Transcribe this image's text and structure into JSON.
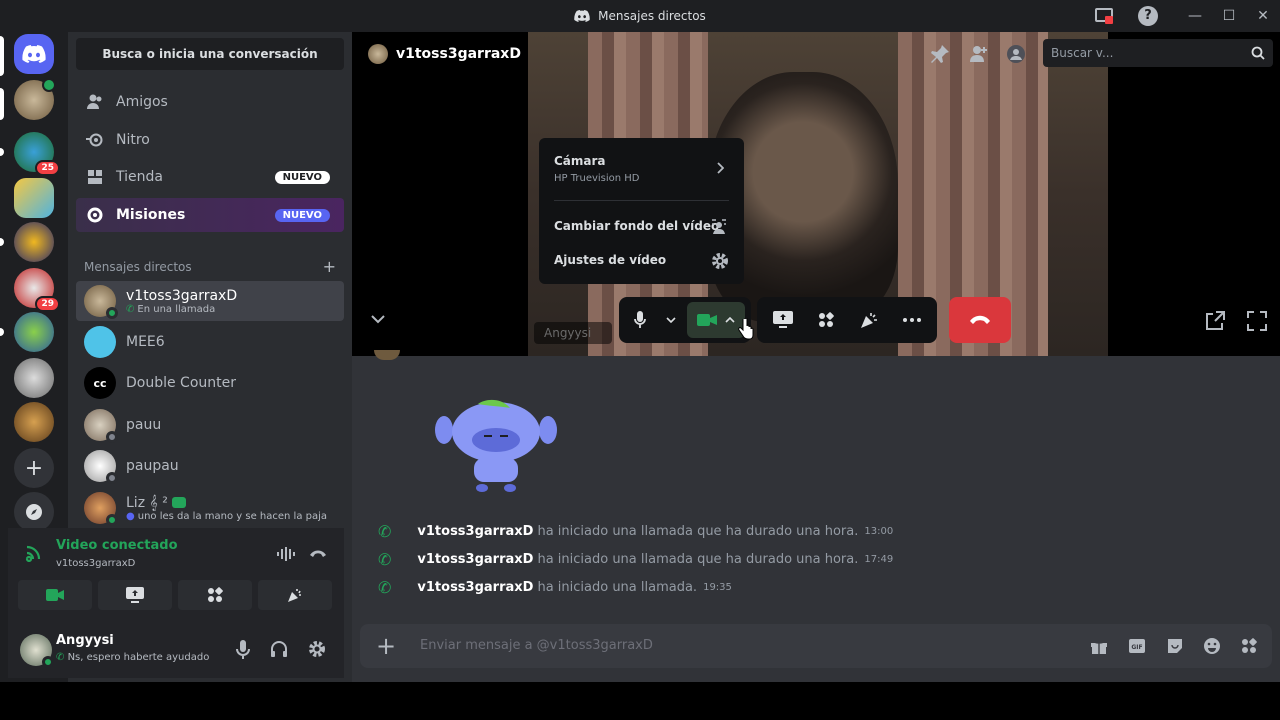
{
  "window": {
    "title": "Mensajes directos"
  },
  "sidebar": {
    "search_label": "Busca o inicia una conversación",
    "nav": [
      {
        "label": "Amigos"
      },
      {
        "label": "Nitro"
      },
      {
        "label": "Tienda",
        "badge": "NUEVO"
      },
      {
        "label": "Misiones",
        "badge": "NUEVO"
      }
    ],
    "dm_header": "Mensajes directos",
    "dm_add": "+",
    "dms": [
      {
        "name": "v1toss3garraxD",
        "status": "En una llamada"
      },
      {
        "name": "MEE6"
      },
      {
        "name": "Double Counter"
      },
      {
        "name": "pauu"
      },
      {
        "name": "paupau"
      },
      {
        "name": "Liz 𝄞 ²",
        "status": "uno les da la mano y se hacen la paja"
      }
    ]
  },
  "guild_badges": [
    "25",
    "29"
  ],
  "voice_panel": {
    "title": "Video conectado",
    "subtitle": "v1toss3garraxD"
  },
  "user_panel": {
    "name": "Angyysi",
    "status": "Ns, espero haberte ayudado"
  },
  "call": {
    "peer_name": "v1toss3garraxD",
    "tile_label": "Angyysi",
    "search_placeholder": "Buscar v..."
  },
  "camera_menu": {
    "camera_label": "Cámara",
    "camera_device": "HP Truevision HD",
    "background_label": "Cambiar fondo del vídeo",
    "settings_label": "Ajustes de vídeo"
  },
  "messages": [
    {
      "user": "v1toss3garraxD",
      "text": "ha iniciado una llamada que ha durado una hora.",
      "time": "13:00"
    },
    {
      "user": "v1toss3garraxD",
      "text": "ha iniciado una llamada que ha durado una hora.",
      "time": "17:49"
    },
    {
      "user": "v1toss3garraxD",
      "text": "ha iniciado una llamada.",
      "time": "19:35"
    }
  ],
  "composer": {
    "placeholder": "Enviar mensaje a @v1toss3garraxD"
  },
  "colors": {
    "accent": "#5865f2",
    "online": "#23a55a",
    "danger": "#da373c",
    "nuevo_tienda": "#ffffff",
    "nuevo_misiones": "#5865f2"
  }
}
